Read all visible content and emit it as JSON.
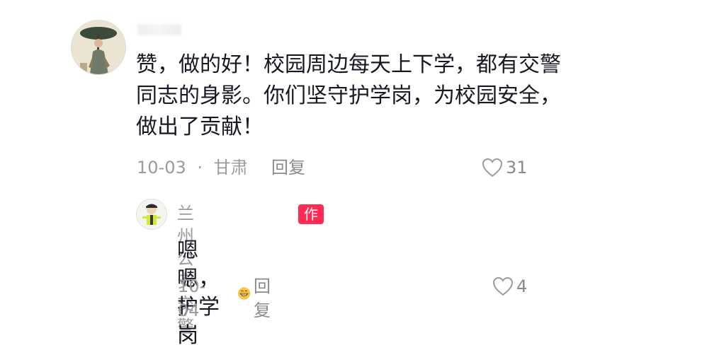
{
  "comment": {
    "username": "",
    "text_lines": [
      "赞，做的好！校园周边每天上下学，都有交警",
      "同志的身影。你们坚守护学岗，为校园安全，",
      "做出了贡献！"
    ],
    "date": "10-03",
    "separator": "·",
    "location": "甘肃",
    "reply_label": "回复",
    "like_count": "31"
  },
  "reply": {
    "username": "兰州公安交警",
    "badge": "作者",
    "text": "嗯嗯，护学岗",
    "emoji": "grinning-face-emoji",
    "date": "10-04",
    "reply_label": "回复",
    "like_count": "4"
  },
  "colors": {
    "text_primary": "#161823",
    "text_secondary": "#9b9b9b",
    "badge_bg": "#fe2c55"
  },
  "icons": [
    "heart-outline-icon",
    "heart-outline-icon"
  ]
}
